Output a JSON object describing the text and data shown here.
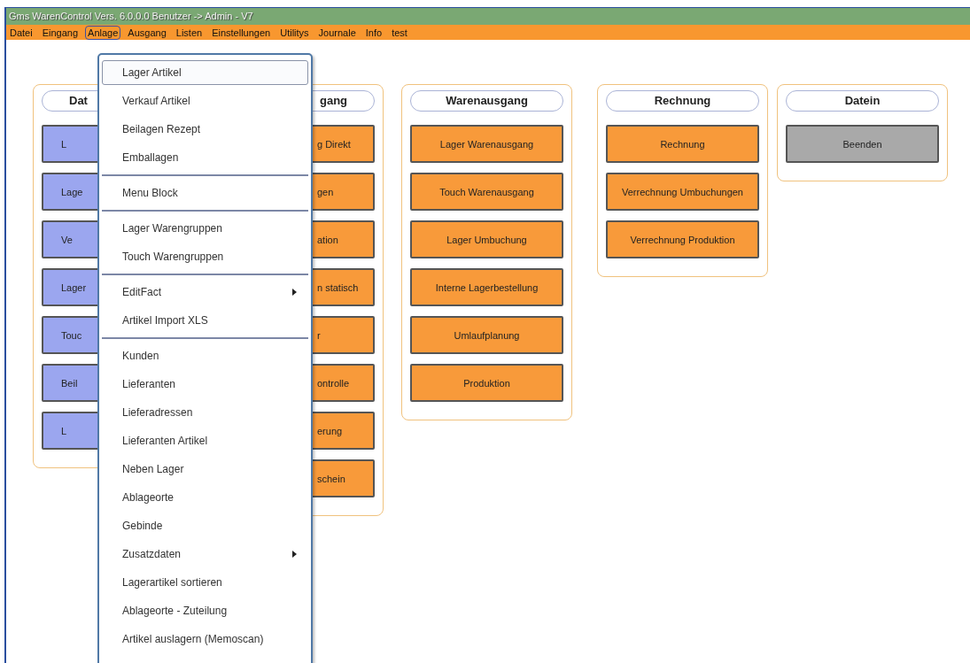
{
  "window": {
    "title": "Gms WarenControl Vers. 6.0.0.0 Benutzer -> Admin - V7"
  },
  "menubar": [
    {
      "label": "Datei",
      "selected": false
    },
    {
      "label": "Eingang",
      "selected": false
    },
    {
      "label": "Anlage",
      "selected": true
    },
    {
      "label": "Ausgang",
      "selected": false
    },
    {
      "label": "Listen",
      "selected": false
    },
    {
      "label": "Einstellungen",
      "selected": false
    },
    {
      "label": "Utilitys",
      "selected": false
    },
    {
      "label": "Journale",
      "selected": false
    },
    {
      "label": "Info",
      "selected": false
    },
    {
      "label": "test",
      "selected": false
    }
  ],
  "panels": [
    {
      "title": "Dat",
      "cut_end": true,
      "cut_start": false,
      "buttons": [
        {
          "label": "L",
          "color": "#9ba6ef"
        },
        {
          "label": "Lage",
          "color": "#9ba6ef"
        },
        {
          "label": "Ve",
          "color": "#9ba6ef"
        },
        {
          "label": "Lager",
          "color": "#9ba6ef"
        },
        {
          "label": "Touc",
          "color": "#9ba6ef"
        },
        {
          "label": "Beil",
          "color": "#9ba6ef"
        },
        {
          "label": "L",
          "color": "#9ba6ef"
        }
      ]
    },
    {
      "title": "gang",
      "cut_end": false,
      "cut_start": true,
      "buttons": [
        {
          "label": "g Direkt",
          "color": "#f89a3a"
        },
        {
          "label": "gen",
          "color": "#f89a3a"
        },
        {
          "label": "ation",
          "color": "#f89a3a"
        },
        {
          "label": "n statisch",
          "color": "#f89a3a"
        },
        {
          "label": "r",
          "color": "#f89a3a"
        },
        {
          "label": "ontrolle",
          "color": "#f89a3a"
        },
        {
          "label": "erung",
          "color": "#f89a3a"
        },
        {
          "label": "schein",
          "color": "#f89a3a"
        }
      ]
    },
    {
      "title": "Warenausgang",
      "buttons": [
        {
          "label": "Lager Warenausgang",
          "color": "#f89a3a"
        },
        {
          "label": "Touch Warenausgang",
          "color": "#f89a3a"
        },
        {
          "label": "Lager Umbuchung",
          "color": "#f89a3a"
        },
        {
          "label": "Interne Lagerbestellung",
          "color": "#f89a3a"
        },
        {
          "label": "Umlaufplanung",
          "color": "#f89a3a"
        },
        {
          "label": "Produktion",
          "color": "#f89a3a"
        }
      ]
    },
    {
      "title": "Rechnung",
      "buttons": [
        {
          "label": "Rechnung",
          "color": "#f89a3a"
        },
        {
          "label": "Verrechnung Umbuchungen",
          "color": "#f89a3a"
        },
        {
          "label": "Verrechnung Produktion",
          "color": "#f89a3a"
        }
      ]
    },
    {
      "title": "Datein",
      "buttons": [
        {
          "label": "Beenden",
          "color": "#a9a9a9"
        }
      ]
    }
  ],
  "dropdown": [
    {
      "kind": "item",
      "label": "Lager Artikel",
      "selected": true,
      "submenu": false
    },
    {
      "kind": "item",
      "label": "Verkauf Artikel",
      "selected": false,
      "submenu": false
    },
    {
      "kind": "item",
      "label": "Beilagen Rezept",
      "selected": false,
      "submenu": false
    },
    {
      "kind": "item",
      "label": "Emballagen",
      "selected": false,
      "submenu": false
    },
    {
      "kind": "separator"
    },
    {
      "kind": "item",
      "label": "Menu Block",
      "selected": false,
      "submenu": false
    },
    {
      "kind": "separator"
    },
    {
      "kind": "item",
      "label": "Lager Warengruppen",
      "selected": false,
      "submenu": false
    },
    {
      "kind": "item",
      "label": "Touch Warengruppen",
      "selected": false,
      "submenu": false
    },
    {
      "kind": "separator"
    },
    {
      "kind": "item",
      "label": "EditFact",
      "selected": false,
      "submenu": true
    },
    {
      "kind": "item",
      "label": "Artikel Import XLS",
      "selected": false,
      "submenu": false
    },
    {
      "kind": "separator"
    },
    {
      "kind": "item",
      "label": "Kunden",
      "selected": false,
      "submenu": false
    },
    {
      "kind": "item",
      "label": "Lieferanten",
      "selected": false,
      "submenu": false
    },
    {
      "kind": "item",
      "label": "Lieferadressen",
      "selected": false,
      "submenu": false
    },
    {
      "kind": "item",
      "label": "Lieferanten Artikel",
      "selected": false,
      "submenu": false
    },
    {
      "kind": "item",
      "label": "Neben Lager",
      "selected": false,
      "submenu": false
    },
    {
      "kind": "item",
      "label": "Ablageorte",
      "selected": false,
      "submenu": false
    },
    {
      "kind": "item",
      "label": "Gebinde",
      "selected": false,
      "submenu": false
    },
    {
      "kind": "item",
      "label": "Zusatzdaten",
      "selected": false,
      "submenu": true
    },
    {
      "kind": "item",
      "label": "Lagerartikel sortieren",
      "selected": false,
      "submenu": false
    },
    {
      "kind": "item",
      "label": "Ablageorte -  Zuteilung",
      "selected": false,
      "submenu": false
    },
    {
      "kind": "item",
      "label": "Artikel auslagern (Memoscan)",
      "selected": false,
      "submenu": false
    }
  ]
}
